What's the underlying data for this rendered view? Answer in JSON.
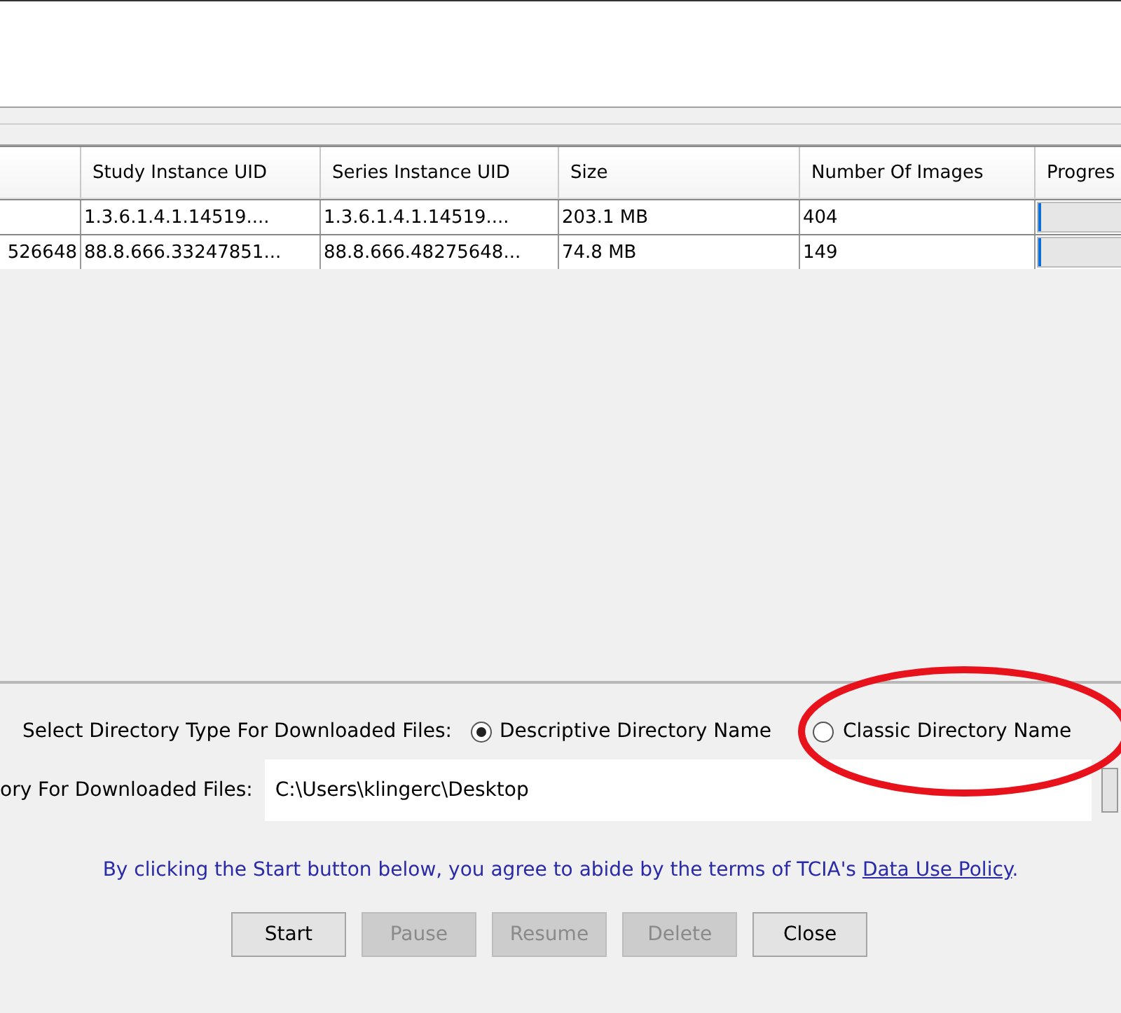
{
  "table": {
    "columns": [
      "",
      "Study Instance UID",
      "Series Instance UID",
      "Size",
      "Number Of Images",
      "Progres"
    ],
    "rows": [
      {
        "cells": [
          "",
          "1.3.6.1.4.1.14519....",
          "1.3.6.1.4.1.14519....",
          "203.1 MB",
          "404"
        ],
        "level": 0.02
      },
      {
        "cells": [
          "526648",
          "88.8.666.33247851...",
          "88.8.666.48275648...",
          "74.8 MB",
          "149"
        ],
        "level": 0.02
      }
    ]
  },
  "directory_type": {
    "label": "Select Directory Type For Downloaded Files:",
    "options": [
      {
        "label": "Descriptive Directory Name",
        "selected": true
      },
      {
        "label": "Classic Directory Name",
        "selected": false
      }
    ]
  },
  "directory": {
    "label": "ory For Downloaded Files:",
    "value": "C:\\Users\\klingerc\\Desktop"
  },
  "notice": {
    "text": "By clicking the Start button below, you agree to abide by the terms of TCIA's",
    "link": "Data Use Policy",
    "end": "."
  },
  "buttons": [
    {
      "label": "Start",
      "disabled": false
    },
    {
      "label": "Pause",
      "disabled": true
    },
    {
      "label": "Resume",
      "disabled": true
    },
    {
      "label": "Delete",
      "disabled": true
    },
    {
      "label": "Close",
      "disabled": false
    }
  ]
}
